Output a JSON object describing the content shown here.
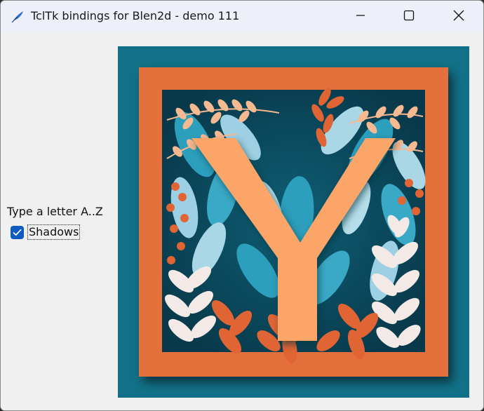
{
  "window": {
    "title": "TclTk bindings for Blen2d - demo 111",
    "icon": "feather-icon"
  },
  "caption_buttons": {
    "minimize": "minimize-icon",
    "maximize": "maximize-icon",
    "close": "close-icon"
  },
  "controls": {
    "prompt_label": "Type a letter A..Z",
    "shadows_label": "Shadows",
    "shadows_checked": true
  },
  "canvas": {
    "letter": "Y",
    "colors": {
      "background": "#127188",
      "frame": "#e4703a",
      "letter": "#fba567",
      "leaf_light": "#9dd0e2",
      "leaf_mid": "#2c9fbd",
      "leaf_white": "#f3e9e6",
      "leaf_orange": "#e06434",
      "leaf_peach": "#f7b98f"
    }
  }
}
